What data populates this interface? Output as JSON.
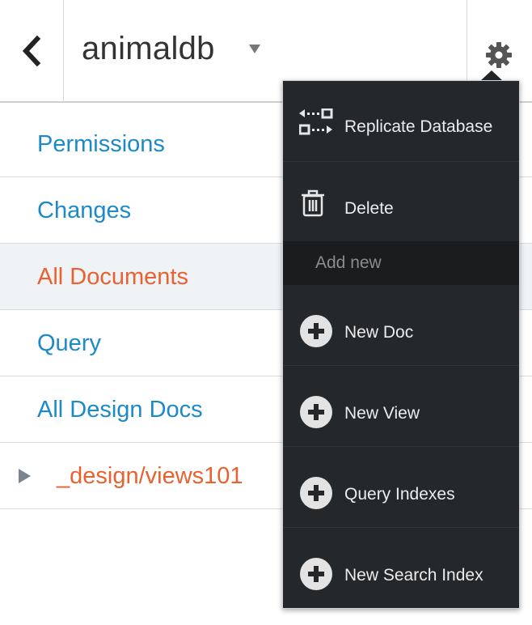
{
  "header": {
    "back_icon": "chevron-left-icon",
    "database_name": "animaldb",
    "dropdown_icon": "caret-down-icon",
    "settings_icon": "gear-icon"
  },
  "nav": {
    "items": [
      {
        "label": "Permissions"
      },
      {
        "label": "Changes"
      },
      {
        "label": "All Documents",
        "active": true
      },
      {
        "label": "Query"
      },
      {
        "label": "All Design Docs"
      },
      {
        "label": "_design/views101",
        "icon": "expand-triangle-icon"
      }
    ]
  },
  "menu": {
    "replicate_label": "Replicate Database",
    "replicate_icon": "replicate-icon",
    "delete_label": "Delete",
    "delete_icon": "trash-icon",
    "section_label": "Add new",
    "new_doc_label": "New Doc",
    "new_view_label": "New View",
    "query_indexes_label": "Query Indexes",
    "new_search_index_label": "New Search Index",
    "add_icon": "plus-circle-icon"
  },
  "colors": {
    "link": "#1c8ac9",
    "active": "#ea6130",
    "menu_bg": "#25282b"
  }
}
